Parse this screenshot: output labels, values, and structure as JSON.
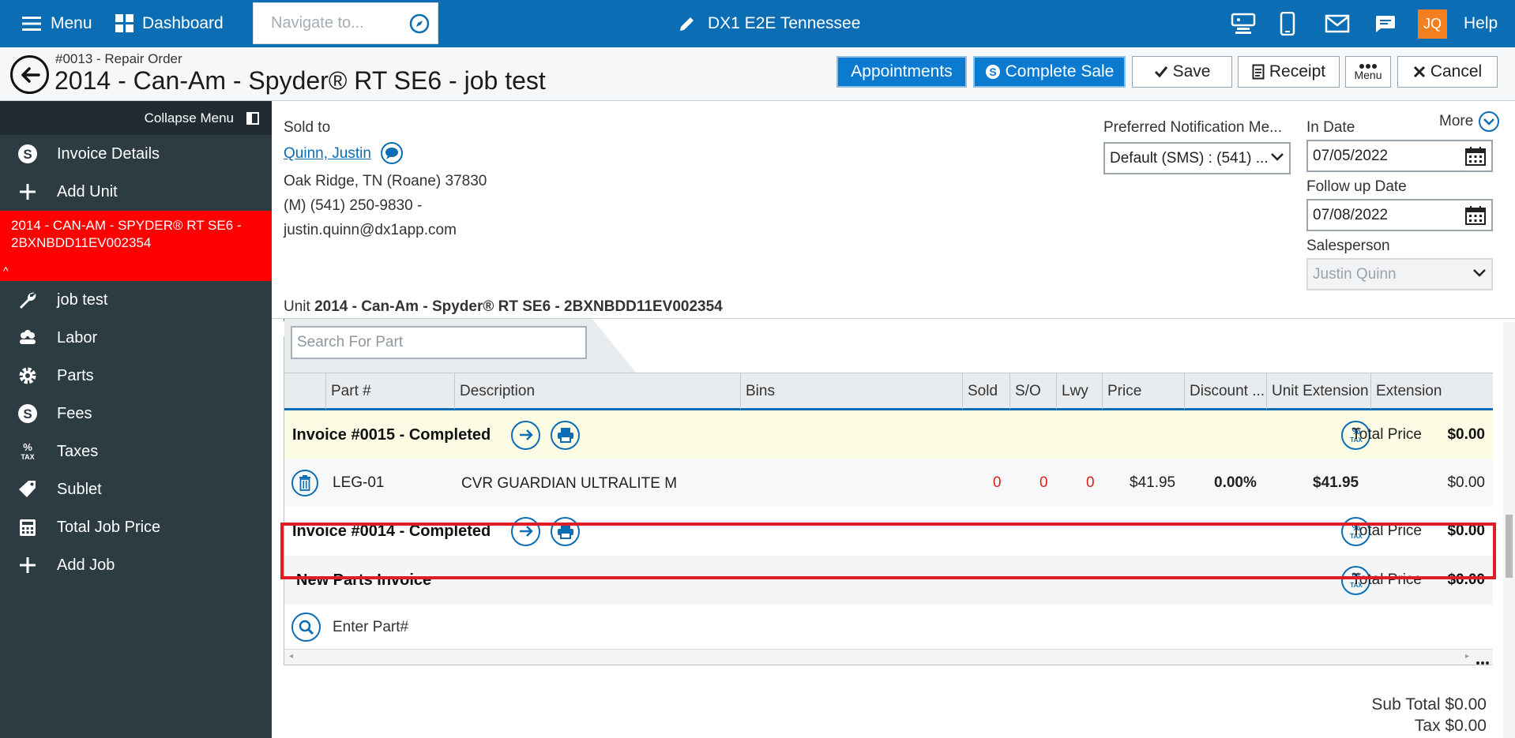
{
  "topbar": {
    "menu_label": "Menu",
    "dashboard_label": "Dashboard",
    "nav_placeholder": "Navigate to...",
    "store_name": "DX1 E2E Tennessee",
    "user_initials": "JQ",
    "help_label": "Help",
    "brand_color": "#0b6eb5"
  },
  "header": {
    "order_number": "#0013 - Repair Order",
    "title": "2014 - Can-Am - Spyder® RT SE6 - job test",
    "buttons": {
      "appointments": "Appointments",
      "complete_sale": "Complete Sale",
      "save": "Save",
      "receipt": "Receipt",
      "menu": "Menu",
      "cancel": "Cancel"
    }
  },
  "sidebar": {
    "collapse_label": "Collapse Menu",
    "items_top": [
      {
        "label": "Invoice Details",
        "icon": "dollar-circle-icon"
      },
      {
        "label": "Add Unit",
        "icon": "plus-icon"
      }
    ],
    "selected_unit": "2014 - CAN-AM - SPYDER® RT SE6 - 2BXNBDD11EV002354",
    "items_bottom": [
      {
        "label": "job test",
        "icon": "wrench-icon"
      },
      {
        "label": "Labor",
        "icon": "labor-icon"
      },
      {
        "label": "Parts",
        "icon": "gear-icon"
      },
      {
        "label": "Fees",
        "icon": "dollar-circle-icon"
      },
      {
        "label": "Taxes",
        "icon": "tax-icon"
      },
      {
        "label": "Sublet",
        "icon": "tag-icon"
      },
      {
        "label": "Total Job Price",
        "icon": "calculator-icon"
      },
      {
        "label": "Add Job",
        "icon": "plus-icon"
      }
    ]
  },
  "customer": {
    "sold_to_label": "Sold to",
    "name": "Quinn, Justin",
    "address": "Oak Ridge, TN (Roane) 37830",
    "phone": "(M) (541) 250-9830 -",
    "email": "justin.quinn@dx1app.com"
  },
  "notification": {
    "label": "Preferred Notification Me...",
    "value": "Default (SMS) : (541) ..."
  },
  "dates": {
    "more_label": "More",
    "in_date_label": "In Date",
    "in_date": "07/05/2022",
    "follow_up_label": "Follow up Date",
    "follow_up": "07/08/2022",
    "salesperson_label": "Salesperson",
    "salesperson": "Justin Quinn"
  },
  "unit": {
    "prefix": "Unit",
    "value": "2014 - Can-Am - Spyder® RT SE6 - 2BXNBDD11EV002354"
  },
  "parts": {
    "search_placeholder": "Search For Part",
    "columns": [
      "Part #",
      "Description",
      "Bins",
      "Sold",
      "S/O",
      "Lwy",
      "Price",
      "Discount ...",
      "Unit Extension",
      "Extension"
    ],
    "invoices": [
      {
        "title": "Invoice #0015 - Completed",
        "total_label": "Total Price",
        "total": "$0.00"
      },
      {
        "title": "Invoice #0014 - Completed",
        "total_label": "Total Price",
        "total": "$0.00"
      }
    ],
    "line": {
      "part": "LEG-01",
      "description": "CVR GUARDIAN ULTRALITE M",
      "sold": "0",
      "so": "0",
      "lwy": "0",
      "price": "$41.95",
      "discount": "0.00%",
      "unit_extension": "$41.95",
      "extension": "$0.00"
    },
    "new_invoice": {
      "title": "New Parts Invoice",
      "total_label": "Total Price",
      "total": "$0.00"
    },
    "enter_part_placeholder": "Enter Part#"
  },
  "summary": {
    "sub_total": "Sub Total $0.00",
    "tax": "Tax $0.00"
  }
}
